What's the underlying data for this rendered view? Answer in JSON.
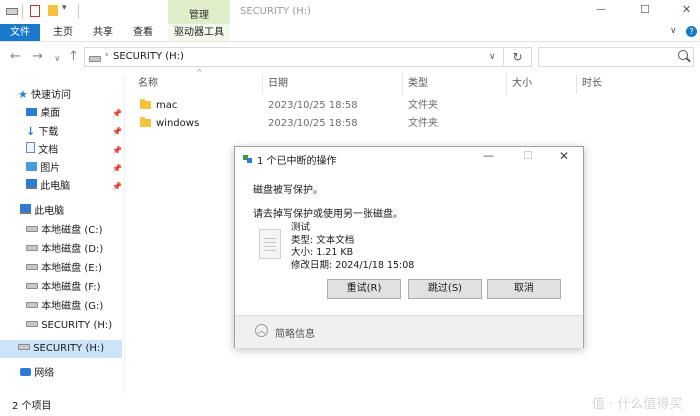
{
  "window": {
    "title": "SECURITY (H:)",
    "minimize": "—",
    "maximize": "☐",
    "close": "✕"
  },
  "quick_access_toolbar": {
    "customize": "▾"
  },
  "ribbon": {
    "manage_tab": "管理",
    "tabs": [
      "文件",
      "主页",
      "共享",
      "查看",
      "驱动器工具"
    ],
    "help": "?",
    "expand": "∨"
  },
  "address": {
    "path": "SECURITY (H:)",
    "refresh": "↻",
    "dropdown": "∨",
    "nav": {
      "back": "←",
      "forward": "→",
      "recent": "∨",
      "up": "↑"
    }
  },
  "columns": {
    "name": "名称",
    "date": "日期",
    "type": "类型",
    "size": "大小",
    "length": "时长"
  },
  "files": [
    {
      "name": "mac",
      "date": "2023/10/25 18:58",
      "type": "文件夹"
    },
    {
      "name": "windows",
      "date": "2023/10/25 18:58",
      "type": "文件夹"
    }
  ],
  "sidebar": {
    "quick_access": "快速访问",
    "quick_items": [
      "桌面",
      "下载",
      "文档",
      "图片",
      "此电脑"
    ],
    "this_pc": "此电脑",
    "drives": [
      "本地磁盘 (C:)",
      "本地磁盘 (D:)",
      "本地磁盘 (E:)",
      "本地磁盘 (F:)",
      "本地磁盘 (G:)",
      "SECURITY (H:)"
    ],
    "selected_drive": "SECURITY (H:)",
    "network": "网络"
  },
  "status": {
    "items": "2 个项目"
  },
  "dialog": {
    "title": "1 个已中断的操作",
    "message": "磁盘被写保护。",
    "hint": "请去掉写保护或使用另一张磁盘。",
    "file_name": "测试",
    "file_type": "类型: 文本文档",
    "file_size": "大小: 1.21 KB",
    "file_modified": "修改日期: 2024/1/18 15:08",
    "buttons": {
      "retry": "重试(R)",
      "skip": "跳过(S)",
      "cancel": "取消"
    },
    "details": "简略信息",
    "details_icon": "︿"
  },
  "watermark": "值 · 什么值得买"
}
